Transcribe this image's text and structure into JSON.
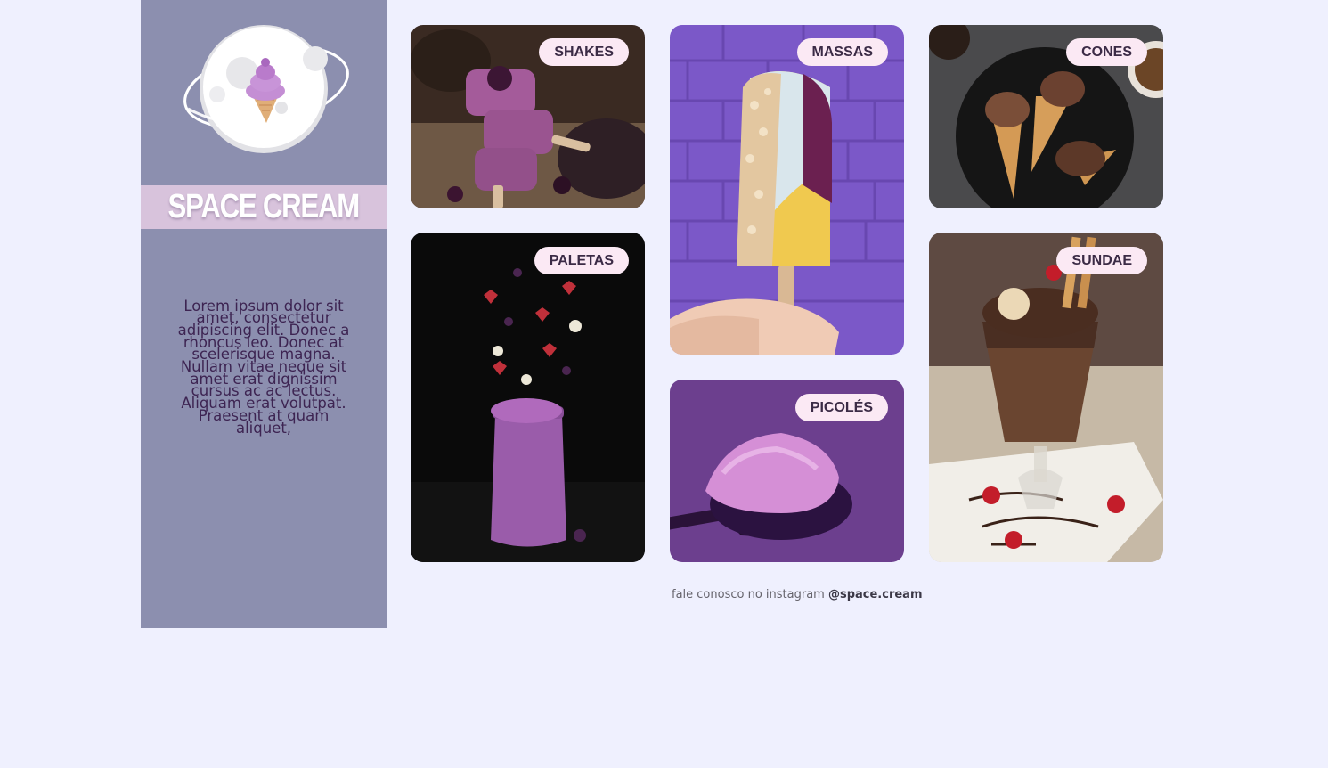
{
  "brand": {
    "title": "SPACE CREAM",
    "logo_icon": "planet-ice-cream-icon",
    "description": "Lorem ipsum dolor sit amet, consectetur adipiscing elit. Donec a rhoncus leo. Donec at scelerisque magna. Nullam vitae neque sit amet erat dignissim cursus ac ac lectus. Aliquam erat volutpat. Praesent at quam aliquet,"
  },
  "categories": [
    {
      "label": "SHAKES"
    },
    {
      "label": "MASSAS"
    },
    {
      "label": "CONES"
    },
    {
      "label": "PALETAS"
    },
    {
      "label": "PICOLÉS"
    },
    {
      "label": "SUNDAE"
    }
  ],
  "footer": {
    "text": "fale conosco no instagram",
    "handle": "@space.cream"
  },
  "colors": {
    "page_background": "#EFF0FE",
    "sidebar": "#8C8FAF",
    "brand_bar": "#D8C3DC",
    "badge": "#FBE9F4",
    "text": "#3D2452"
  }
}
